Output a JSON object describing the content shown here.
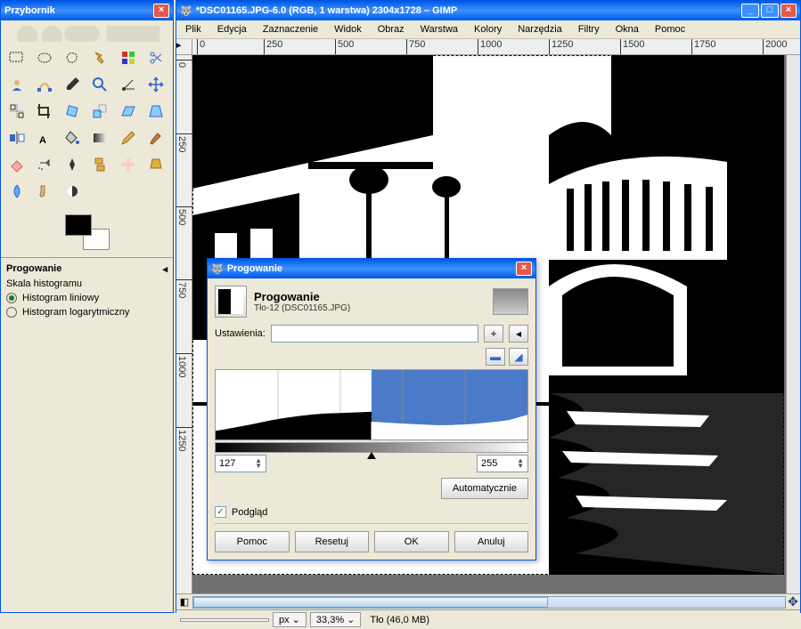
{
  "toolbox": {
    "title": "Przybornik",
    "opt_title": "Progowanie",
    "scale_label": "Skala histogramu",
    "radio1": "Histogram liniowy",
    "radio2": "Histogram logarytmiczny"
  },
  "mainwin": {
    "title": "*DSC01165.JPG-6.0 (RGB, 1 warstwa) 2304x1728 – GIMP",
    "menu": [
      "Plik",
      "Edycja",
      "Zaznaczenie",
      "Widok",
      "Obraz",
      "Warstwa",
      "Kolory",
      "Narzędzia",
      "Filtry",
      "Okna",
      "Pomoc"
    ],
    "ruler_h": [
      "0",
      "250",
      "500",
      "750",
      "1000",
      "1250",
      "1500",
      "1750",
      "2000"
    ],
    "ruler_v": [
      "0",
      "250",
      "500",
      "750",
      "1000",
      "1250"
    ],
    "unit": "px",
    "zoom": "33,3%",
    "status": "Tło (46,0 MB)"
  },
  "dialog": {
    "title": "Progowanie",
    "head_title": "Progowanie",
    "head_sub": "Tło-12 (DSC01165.JPG)",
    "settings_label": "Ustawienia:",
    "val_low": "127",
    "val_high": "255",
    "auto_btn": "Automatycznie",
    "preview_chk": "Podgląd",
    "btn_help": "Pomoc",
    "btn_reset": "Resetuj",
    "btn_ok": "OK",
    "btn_cancel": "Anuluj"
  }
}
